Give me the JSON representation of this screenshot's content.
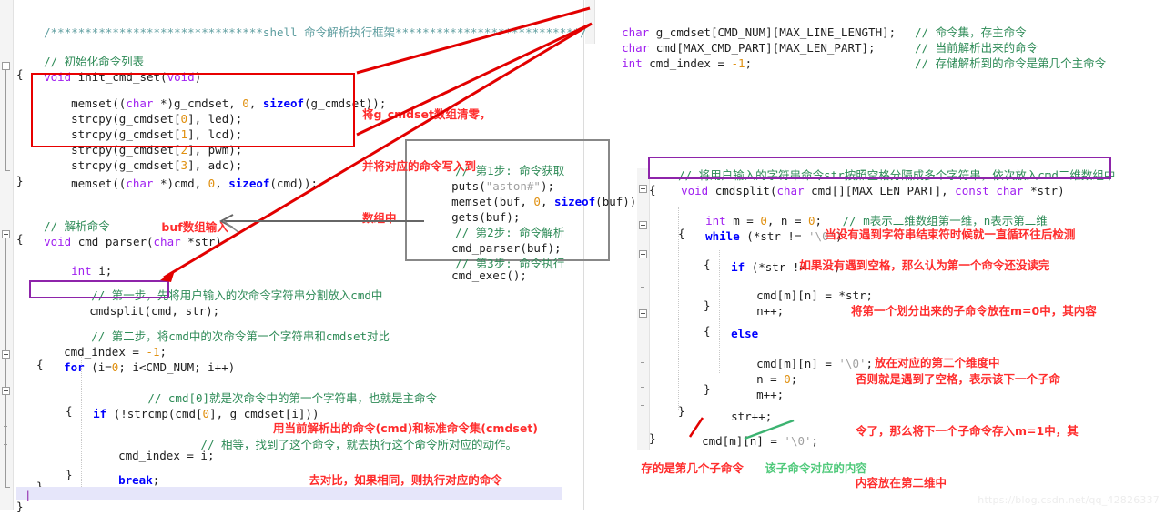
{
  "watermark": "https://blog.csdn.net/qq_42826337",
  "left_pane": {
    "header_comment": "/*******************************shell 命令解析执行框架***************************/",
    "lines": [
      "// 初始化命令列表",
      "void init_cmd_set(void)",
      "{",
      "    memset((char *)g_cmdset, 0, sizeof(g_cmdset));",
      "    strcpy(g_cmdset[0], led);",
      "    strcpy(g_cmdset[1], lcd);",
      "    strcpy(g_cmdset[2], pwm);",
      "    strcpy(g_cmdset[3], adc);",
      "    memset((char *)cmd, 0, sizeof(cmd));",
      "}",
      "// 解析命令",
      "void cmd_parser(char *str)",
      "{",
      "    int i;",
      "    // 第一步，先将用户输入的次命令字符串分割放入cmd中",
      "    cmdsplit(cmd, str);",
      "    // 第二步，将cmd中的次命令第一个字符串和cmdset对比",
      "    cmd_index = -1;",
      "    for (i=0; i<CMD_NUM; i++)",
      "    {",
      "        // cmd[0]就是次命令中的第一个字符串，也就是主命令",
      "        if (!strcmp(cmd[0], g_cmdset[i]))",
      "        {",
      "            // 相等，找到了这个命令，就去执行这个命令所对应的动作。",
      "            cmd_index = i;",
      "            break;",
      "        }",
      "    }",
      "}"
    ]
  },
  "mid_box": {
    "lines": [
      "// 第1步: 命令获取",
      "puts(\"aston#\");",
      "memset(buf, 0, sizeof(buf));",
      "gets(buf);",
      "// 第2步: 命令解析",
      "cmd_parser(buf);",
      "// 第3步: 命令执行",
      "cmd_exec();"
    ]
  },
  "top_right_decls": {
    "code": [
      "char g_cmdset[CMD_NUM][MAX_LINE_LENGTH];",
      "char cmd[MAX_CMD_PART][MAX_LEN_PART];",
      "int cmd_index = -1;"
    ],
    "comments": [
      "// 命令集，存主命令",
      "// 当前解析出来的命令",
      "// 存储解析到的命令是第几个主命令"
    ]
  },
  "right_pane": {
    "top_comment": "// 将用户输入的字符串命令str按照空格分隔成多个字符串，依次放入cmd二维数组中",
    "signature": "void cmdsplit(char cmd[][MAX_LEN_PART], const char *str)",
    "lines": [
      "{",
      "    int m = 0, n = 0;    // m表示二维数组第一维，n表示第二维",
      "    while (*str != '\\0')",
      "    {",
      "        if (*str != ' ')",
      "        {",
      "            cmd[m][n] = *str;",
      "            n++;",
      "        }",
      "        else",
      "        {",
      "            cmd[m][n] = '\\0';",
      "            n = 0;",
      "            m++;",
      "        }",
      "        str++;",
      "    }",
      "    cmd[m][n] = '\\0';",
      "}"
    ]
  },
  "annotations": {
    "cmdset_clear": [
      "将g_cmdset数组清零，",
      "并将对应的命令写入到",
      "数组中"
    ],
    "buf_input": "buf数组输入",
    "strcmp_note": [
      "用当前解析出的命令(cmd)和标准命令集(cmdset)",
      "去对比，如果相同，则执行对应的命令"
    ],
    "while_note": "当没有遇到字符串结束符时候就一直循环往后检测",
    "if_note": "如果没有遇到空格，那么认为第一个命令还没读完",
    "assign_note": [
      "将第一个划分出来的子命令放在m=0中，其内容",
      "放在对应的第二个维度中"
    ],
    "else_note": [
      "否则就是遇到了空格，表示该下一个子命",
      "令了，那么将下一个子命令存入m=1中，其",
      "内容放在第二维中"
    ],
    "bottom_red": "存的是第几个子命令",
    "bottom_green": "该子命令对应的内容"
  },
  "colors": {
    "red_box": "#e80000",
    "purple_box": "#8e24aa",
    "gray_box": "#888888",
    "annotation_red": "#ff2d2d",
    "annotation_green": "#4fc97a",
    "comment_green": "#2e8b57",
    "keyword_blue": "#0000ff",
    "type_purple": "#a020f0",
    "number_orange": "#e09010",
    "highlight_line": "#e6e6fa"
  }
}
